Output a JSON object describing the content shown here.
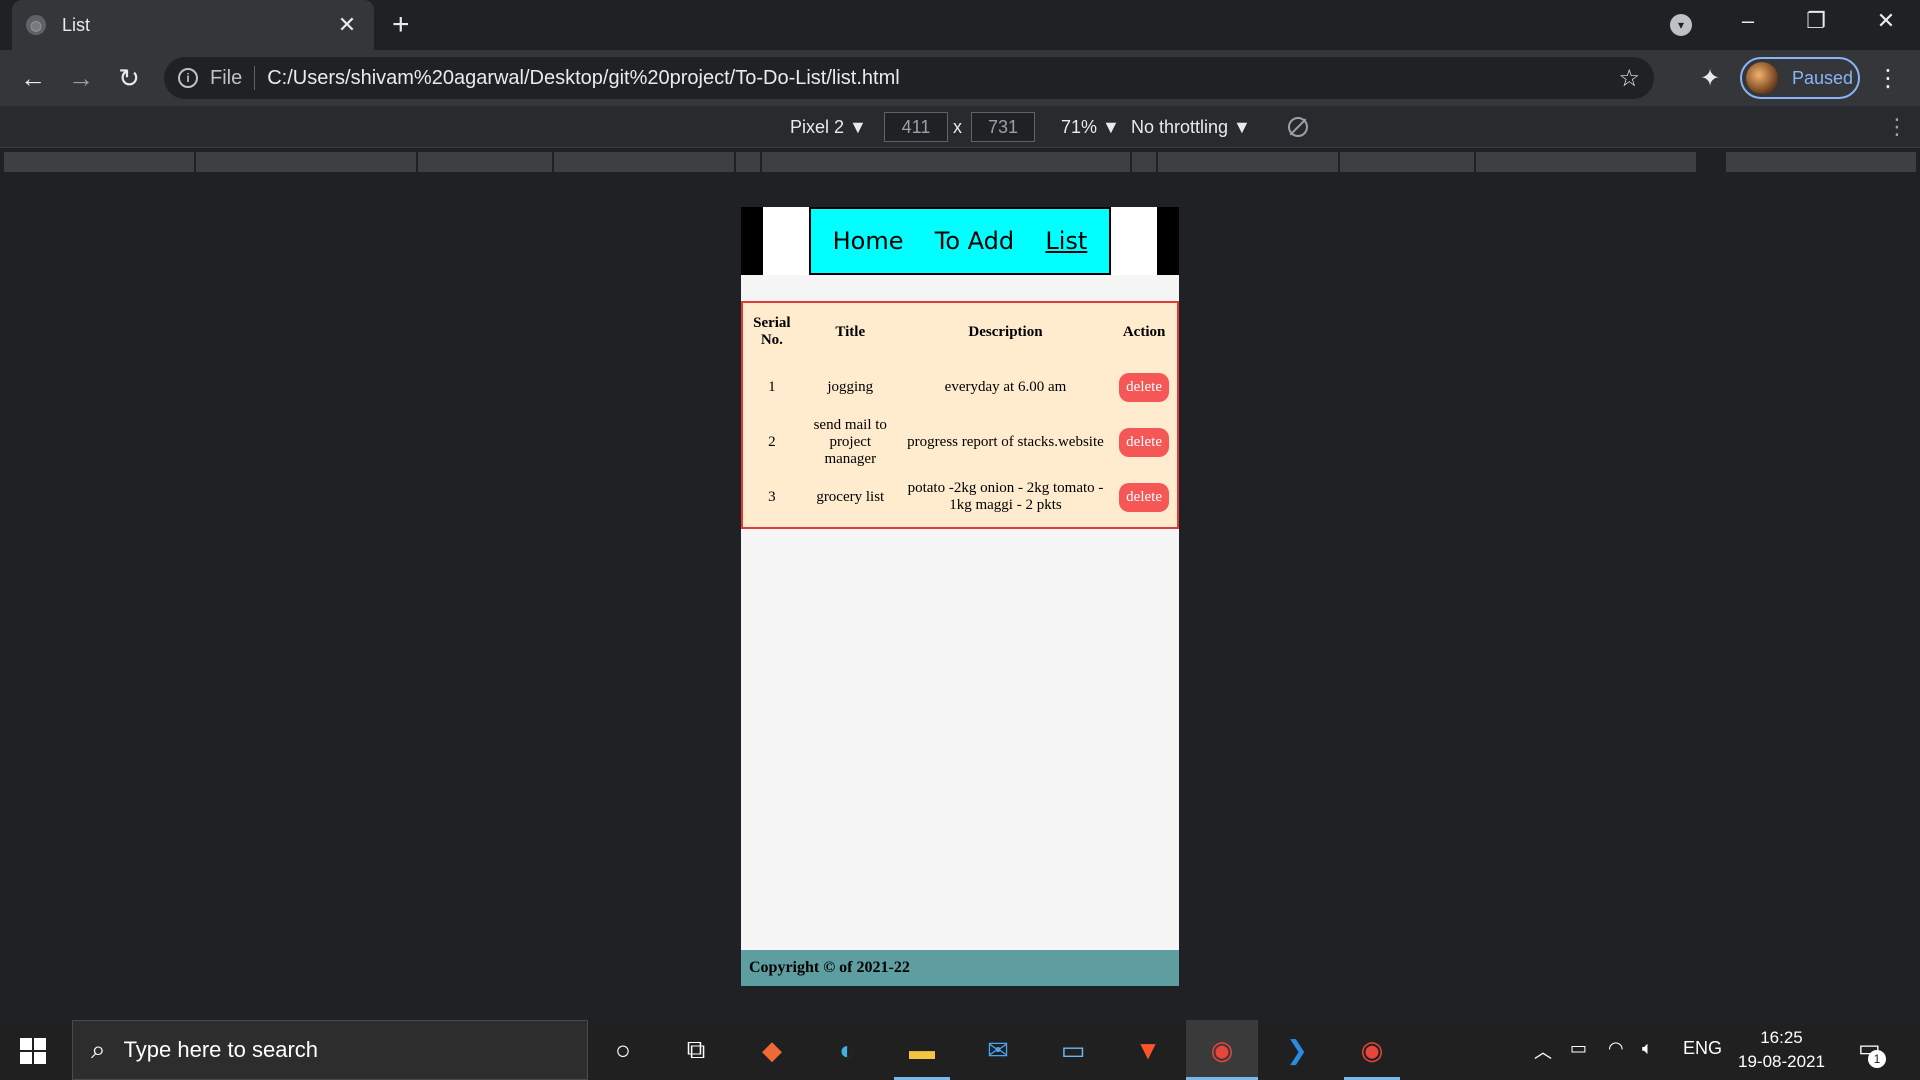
{
  "browser": {
    "tab_title": "List",
    "tab_close": "✕",
    "new_tab": "+",
    "scheme": "File",
    "url": "C:/Users/shivam%20agarwal/Desktop/git%20project/To-Do-List/list.html",
    "profile_label": "Paused",
    "icons": [
      "back-icon",
      "forward-icon",
      "reload-icon",
      "info-icon",
      "star-icon",
      "extensions-icon",
      "menu-icon"
    ]
  },
  "devtools": {
    "device": "Pixel 2 ▼",
    "width": "411",
    "times": "x",
    "height": "731",
    "zoom": "71% ▼",
    "throttling": "No throttling ▼"
  },
  "page": {
    "nav": [
      {
        "label": "Home"
      },
      {
        "label": "To Add"
      },
      {
        "label": "List"
      }
    ],
    "table": {
      "headers": [
        "Serial No.",
        "Title",
        "Description",
        "Action"
      ],
      "rows": [
        {
          "serial": "1",
          "title": "jogging",
          "description": "everyday at 6.00 am",
          "action": "delete"
        },
        {
          "serial": "2",
          "title": "send mail to project manager",
          "description": "progress report of stacks.website",
          "action": "delete"
        },
        {
          "serial": "3",
          "title": "grocery list",
          "description": "potato -2kg onion - 2kg tomato - 1kg maggi - 2 pkts",
          "action": "delete"
        }
      ]
    },
    "footer": "Copyright © of 2021-22"
  },
  "taskbar": {
    "search_placeholder": "Type here to search",
    "tray_lang": "ENG",
    "time": "16:25",
    "date": "19-08-2021",
    "notification_count": "1"
  }
}
